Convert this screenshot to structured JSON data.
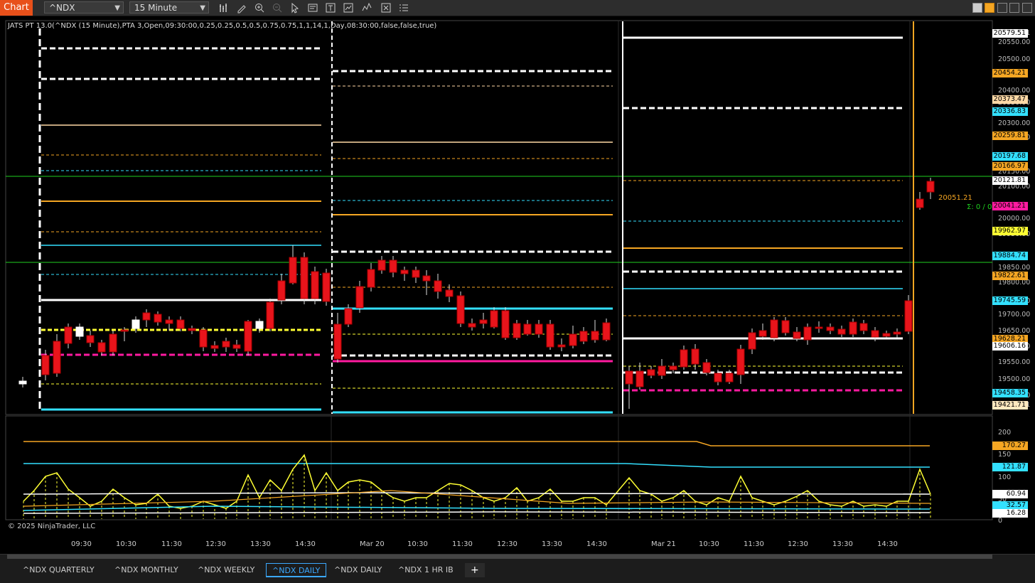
{
  "window": {
    "title": "Chart",
    "instrument": "^NDX",
    "interval": "15 Minute"
  },
  "toolbar": {
    "icons": [
      "bar-type-icon",
      "draw-icon",
      "zoom-in-icon",
      "zoom-out-icon",
      "pointer-icon",
      "data-box-icon",
      "properties-icon",
      "strategies-icon",
      "indicators-icon",
      "templates-icon",
      "list-icon"
    ]
  },
  "indicator_label": "JATS PT 13.0(^NDX (15 Minute),PTA 3,Open,09:30:00,0.25,0.25,0.5,0.5,0.75,0.75,1,1,14,1,Day,08:30:00,false,false,true)",
  "copyright": "© 2025 NinjaTrader, LLC",
  "price_axis": [
    "20579.51",
    "20550.00",
    "20500.00",
    "20400.00",
    "20350.00",
    "20300.00",
    "20250.00",
    "20150.00",
    "20100.00",
    "20000.00",
    "19950.00",
    "19850.00",
    "19800.00",
    "19750.00",
    "19700.00",
    "19650.00",
    "19600.00",
    "19550.00",
    "19500.00",
    "19450.00",
    "19421.71"
  ],
  "price_markers": [
    {
      "value": "20579.51",
      "color": "#ffffff"
    },
    {
      "value": "20454.21",
      "color": "#f5a623"
    },
    {
      "value": "20373.47",
      "color": "#ffd9a6"
    },
    {
      "value": "20336.83",
      "color": "#33e0ff"
    },
    {
      "value": "20259.81",
      "color": "#f5a623"
    },
    {
      "value": "20197.68",
      "color": "#33e0ff"
    },
    {
      "value": "20166.97",
      "color": "#f5a623"
    },
    {
      "value": "20121.81",
      "color": "#ffffff"
    },
    {
      "value": "20041.21",
      "color": "#ff1aa0"
    },
    {
      "value": "19962.97",
      "color": "#ffff33"
    },
    {
      "value": "19884.74",
      "color": "#33e0ff"
    },
    {
      "value": "19822.61",
      "color": "#f5a623"
    },
    {
      "value": "19745.59",
      "color": "#33e0ff"
    },
    {
      "value": "19628.21",
      "color": "#f5a623"
    },
    {
      "value": "19606.16",
      "color": "#ffffff"
    },
    {
      "value": "19458.35",
      "color": "#33e0ff"
    },
    {
      "value": "19421.71",
      "color": "#ffe9c0"
    }
  ],
  "last_price_text": "20051.21",
  "sigma_text": "Σ: 0 / 0",
  "lower_panel": {
    "axis": [
      "200",
      "150",
      "100",
      "50",
      "0"
    ],
    "markers": [
      {
        "value": "170.27",
        "color": "#f5a623"
      },
      {
        "value": "121.87",
        "color": "#33e0ff"
      },
      {
        "value": "60.94",
        "color": "#ffffff"
      },
      {
        "value": "32.57",
        "color": "#33e0ff"
      },
      {
        "value": "16.28",
        "color": "#ffffff"
      }
    ]
  },
  "time_axis": [
    "09:30",
    "10:30",
    "11:30",
    "12:30",
    "13:30",
    "14:30",
    "Mar 20",
    "10:30",
    "11:30",
    "12:30",
    "13:30",
    "14:30",
    "Mar 21",
    "10:30",
    "11:30",
    "12:30",
    "13:30",
    "14:30"
  ],
  "tabs": [
    {
      "label": "^NDX QUARTERLY",
      "active": false
    },
    {
      "label": "^NDX MONTHLY",
      "active": false
    },
    {
      "label": "^NDX WEEKLY",
      "active": false
    },
    {
      "label": "^NDX DAILY",
      "active": true
    },
    {
      "label": "^NDX DAILY",
      "active": false
    },
    {
      "label": "^NDX 1 HR IB",
      "active": false
    }
  ],
  "add_tab_label": "+",
  "colors": {
    "accent": "#e8501a",
    "active_tab": "#3ba8ff",
    "bull": "#ffffff",
    "bear": "#e8141b",
    "green_line": "#1fd11f"
  }
}
